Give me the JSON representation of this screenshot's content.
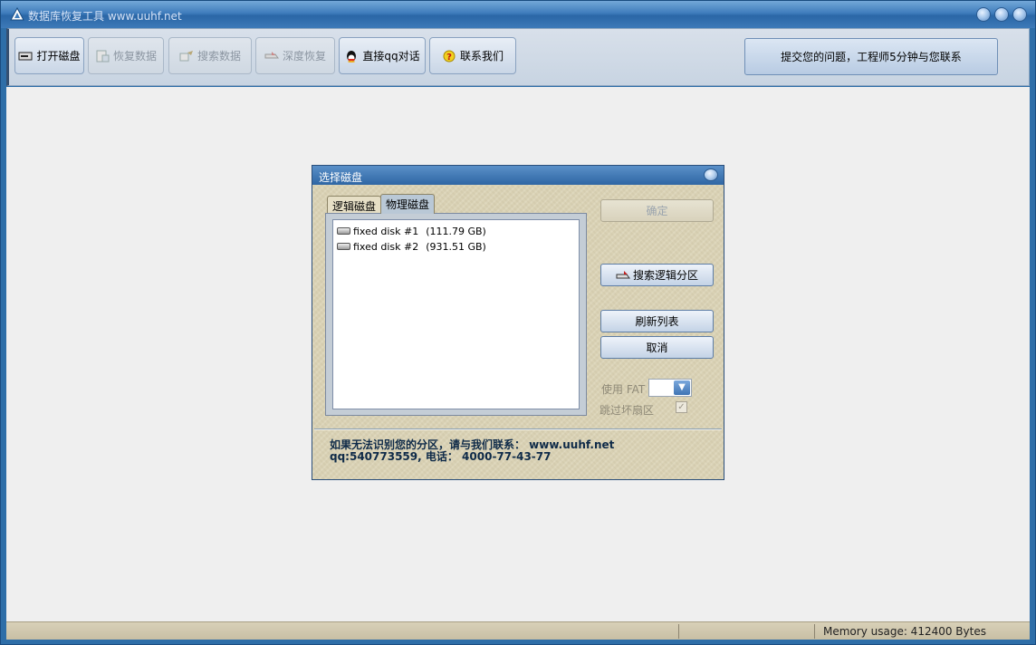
{
  "window": {
    "title": "数据库恢复工具 www.uuhf.net"
  },
  "toolbar": {
    "buttons": [
      {
        "label": "打开磁盘",
        "icon": "disk-icon",
        "enabled": true
      },
      {
        "label": "恢复数据",
        "icon": "restore-icon",
        "enabled": false
      },
      {
        "label": "搜索数据",
        "icon": "search-data-icon",
        "enabled": false
      },
      {
        "label": "深度恢复",
        "icon": "deep-restore-icon",
        "enabled": false
      },
      {
        "label": "直接qq对话",
        "icon": "qq-icon",
        "enabled": true
      },
      {
        "label": "联系我们",
        "icon": "help-icon",
        "enabled": true
      }
    ],
    "submit_label": "提交您的问题，工程师5分钟与您联系"
  },
  "dialog": {
    "title": "选择磁盘",
    "tabs": [
      {
        "label": "逻辑磁盘",
        "active": false
      },
      {
        "label": "物理磁盘",
        "active": true
      }
    ],
    "disks": [
      {
        "name": "fixed disk #1",
        "size": "(111.79 GB)"
      },
      {
        "name": "fixed disk #2",
        "size": "(931.51 GB)"
      }
    ],
    "buttons": {
      "ok": "确定",
      "search_partition": "搜索逻辑分区",
      "refresh": "刷新列表",
      "cancel": "取消"
    },
    "options": {
      "use_fat_label": "使用 FAT",
      "skip_bad_label": "跳过坏扇区",
      "skip_bad_checked": true
    },
    "contact_line1": "如果无法识别您的分区，请与我们联系： www.uuhf.net",
    "contact_line2": "qq:540773559, 电话： 4000-77-43-77"
  },
  "statusbar": {
    "memory": "Memory usage: 412400 Bytes"
  },
  "colors": {
    "title_blue": "#2e6ea8",
    "dialog_bg": "#d9d1b4",
    "contact_text": "#0e2a48"
  }
}
